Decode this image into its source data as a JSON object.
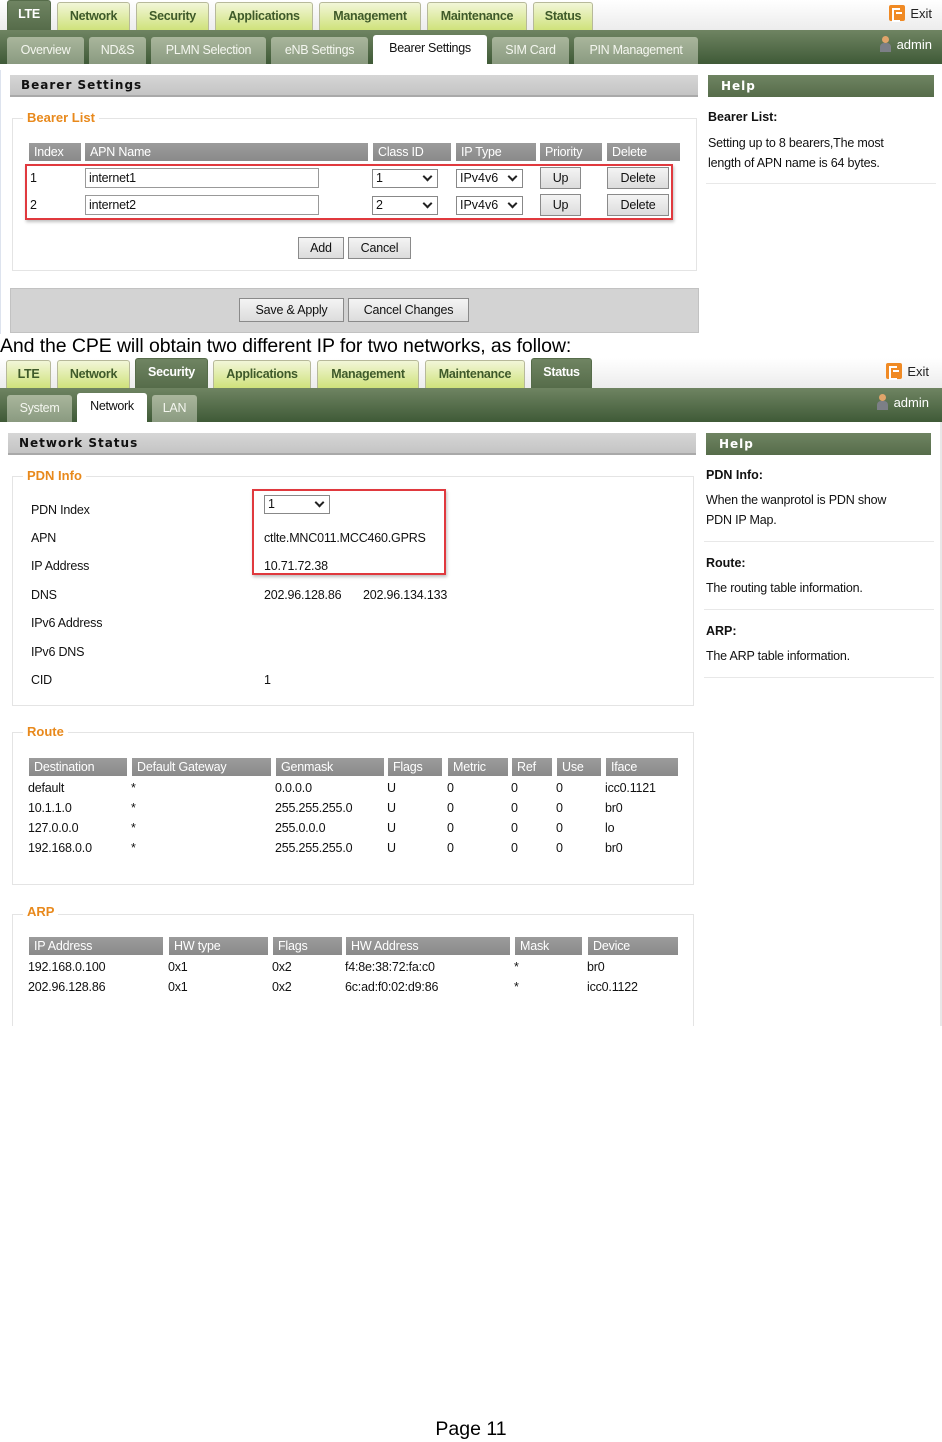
{
  "screen1": {
    "top_tabs": [
      "LTE",
      "Network",
      "Security",
      "Applications",
      "Management",
      "Maintenance",
      "Status"
    ],
    "active_top_tab": "LTE",
    "sub_tabs": [
      "Overview",
      "ND&S",
      "PLMN Selection",
      "eNB Settings",
      "Bearer Settings",
      "SIM Card",
      "PIN Management"
    ],
    "active_sub_tab": "Bearer Settings",
    "exit_label": "Exit",
    "user_label": "admin",
    "section_title": "Bearer Settings",
    "bearer_list": {
      "legend": "Bearer List",
      "headers": [
        "Index",
        "APN Name",
        "Class ID",
        "IP Type",
        "Priority",
        "Delete"
      ],
      "rows": [
        {
          "index": "1",
          "apn": "internet1",
          "class_id": "1",
          "ip_type": "IPv4v6",
          "priority_btn": "Up",
          "delete_btn": "Delete"
        },
        {
          "index": "2",
          "apn": "internet2",
          "class_id": "2",
          "ip_type": "IPv4v6",
          "priority_btn": "Up",
          "delete_btn": "Delete"
        }
      ],
      "add_label": "Add",
      "cancel_label": "Cancel"
    },
    "save_label": "Save & Apply",
    "cancel_changes_label": "Cancel Changes",
    "help": {
      "title": "Help",
      "items": [
        {
          "heading": "Bearer List:",
          "text": [
            "Setting up to 8 bearers,The most",
            "length of APN name is 64 bytes."
          ]
        }
      ]
    }
  },
  "caption": "And the CPE will obtain two different IP for two networks, as follow:",
  "screen2": {
    "top_tabs": [
      "LTE",
      "Network",
      "Security",
      "Applications",
      "Management",
      "Maintenance",
      "Status"
    ],
    "active_top_tabs": [
      "Security",
      "Status"
    ],
    "sub_tabs": [
      "System",
      "Network",
      "LAN"
    ],
    "active_sub_tab": "Network",
    "exit_label": "Exit",
    "user_label": "admin",
    "section_title": "Network Status",
    "pdn_info": {
      "legend": "PDN Info",
      "fields": [
        {
          "label": "PDN Index",
          "value": "1"
        },
        {
          "label": "APN",
          "value": "ctlte.MNC011.MCC460.GPRS"
        },
        {
          "label": "IP Address",
          "value": "10.71.72.38"
        },
        {
          "label": "DNS",
          "value": "202.96.128.86",
          "value2": "202.96.134.133"
        },
        {
          "label": "IPv6 Address",
          "value": ""
        },
        {
          "label": "IPv6 DNS",
          "value": ""
        },
        {
          "label": "CID",
          "value": "1"
        }
      ]
    },
    "route": {
      "legend": "Route",
      "headers": [
        "Destination",
        "Default Gateway",
        "Genmask",
        "Flags",
        "Metric",
        "Ref",
        "Use",
        "Iface"
      ],
      "rows": [
        [
          "default",
          "*",
          "0.0.0.0",
          "U",
          "0",
          "0",
          "0",
          "icc0.1121"
        ],
        [
          "10.1.1.0",
          "*",
          "255.255.255.0",
          "U",
          "0",
          "0",
          "0",
          "br0"
        ],
        [
          "127.0.0.0",
          "*",
          "255.0.0.0",
          "U",
          "0",
          "0",
          "0",
          "lo"
        ],
        [
          "192.168.0.0",
          "*",
          "255.255.255.0",
          "U",
          "0",
          "0",
          "0",
          "br0"
        ]
      ]
    },
    "arp": {
      "legend": "ARP",
      "headers": [
        "IP Address",
        "HW type",
        "Flags",
        "HW Address",
        "Mask",
        "Device"
      ],
      "rows": [
        [
          "192.168.0.100",
          "0x1",
          "0x2",
          "f4:8e:38:72:fa:c0",
          "*",
          "br0"
        ],
        [
          "202.96.128.86",
          "0x1",
          "0x2",
          "6c:ad:f0:02:d9:86",
          "*",
          "icc0.1122"
        ]
      ]
    },
    "help": {
      "title": "Help",
      "items": [
        {
          "heading": "PDN Info:",
          "text": [
            "When the wanprotol is PDN show",
            "PDN IP Map."
          ]
        },
        {
          "heading": "Route:",
          "text": [
            "The routing table information."
          ]
        },
        {
          "heading": "ARP:",
          "text": [
            "The ARP table information."
          ]
        }
      ]
    }
  },
  "page_label": "Page 11",
  "colors": {
    "accent_green": "#566c4a",
    "tab_lime": "#cfe27b",
    "legend_orange": "#e8891c",
    "highlight_red": "#e0393e",
    "exit_orange": "#f08a24"
  }
}
